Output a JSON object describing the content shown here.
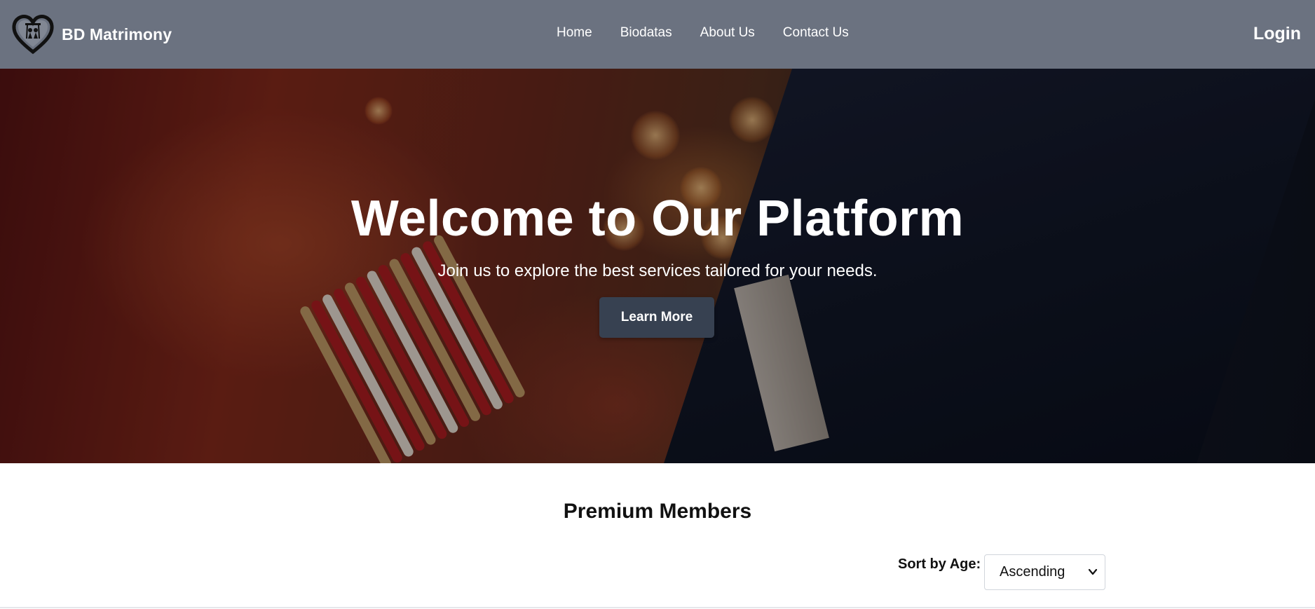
{
  "brand": {
    "name": "BD Matrimony",
    "logo_icon": "heart-couple-logo-icon"
  },
  "nav": {
    "items": [
      {
        "label": "Home"
      },
      {
        "label": "Biodatas"
      },
      {
        "label": "About Us"
      },
      {
        "label": "Contact Us"
      }
    ]
  },
  "auth": {
    "login_label": "Login"
  },
  "hero": {
    "title": "Welcome to Our Platform",
    "subtitle": "Join us to explore the best services tailored for your needs.",
    "button_label": "Learn More"
  },
  "premium": {
    "title": "Premium Members",
    "sort_label": "Sort by Age:",
    "sort_value": "Ascending"
  },
  "colors": {
    "navbar": "#6b7280",
    "button": "#374151",
    "text": "#111111"
  }
}
